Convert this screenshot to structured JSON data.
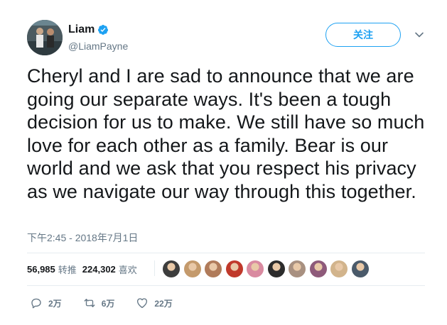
{
  "user": {
    "display_name": "Liam",
    "handle": "@LiamPayne",
    "verified": true
  },
  "follow_button": {
    "label": "关注"
  },
  "tweet": {
    "text": "Cheryl and I are sad to announce that we are going our separate ways. It's been a tough decision for us to make. We still have so much love for each other as a family. Bear is our world and we ask that you respect his privacy as we navigate our way through this together.",
    "timestamp": "下午2:45 - 2018年7月1日"
  },
  "stats": {
    "retweets_count": "56,985",
    "retweets_label": "转推",
    "likes_count": "224,302",
    "likes_label": "喜欢"
  },
  "liker_avatars": [
    "#3d3d3d",
    "#c49a6c",
    "#b07b5a",
    "#c0392b",
    "#d98aa0",
    "#2c2c2c",
    "#a89080",
    "#8e5a7a",
    "#d2b48c",
    "#4a5a6a"
  ],
  "actions": {
    "reply_count": "2万",
    "retweet_count": "6万",
    "like_count": "22万"
  },
  "colors": {
    "accent": "#1da1f2",
    "muted": "#657786",
    "text": "#14171a"
  }
}
